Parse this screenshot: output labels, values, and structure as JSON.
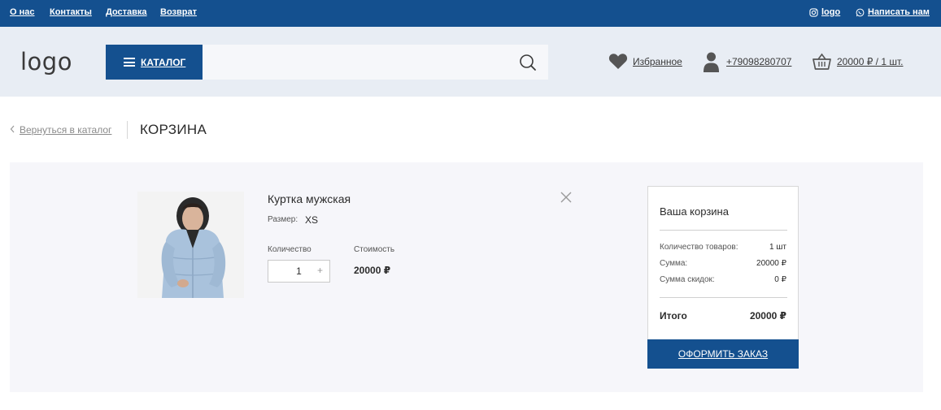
{
  "topbar": {
    "links": [
      "О нас",
      "Контакты",
      "Доставка",
      "Возврат"
    ],
    "instagram_label": "logo",
    "whatsapp_label": "Написать нам",
    "instagram_icon": "instagram-icon",
    "whatsapp_icon": "whatsapp-icon"
  },
  "header": {
    "logo": "logo",
    "catalog_label": "КАТАЛОГ",
    "search_placeholder": "",
    "favorites_label": "Избранное",
    "phone": "+79098280707",
    "cart_label": "20000 ₽ / 1 шт."
  },
  "breadcrumb": {
    "back_label": "Вернуться в каталог",
    "title": "КОРЗИНА"
  },
  "cart_item": {
    "name": "Куртка мужская",
    "size_label": "Размер:",
    "size_value": "XS",
    "quantity_label": "Количество",
    "quantity": "1",
    "cost_label": "Стоимость",
    "price": "20000 ₽"
  },
  "summary": {
    "title": "Ваша корзина",
    "rows": [
      {
        "label": "Количество товаров:",
        "value": "1 шт"
      },
      {
        "label": "Сумма:",
        "value": "20000 ₽"
      },
      {
        "label": "Сумма скидок:",
        "value": "0 ₽"
      }
    ],
    "total_label": "Итого",
    "total_value": "20000 ₽",
    "checkout_label": "ОФОРМИТЬ ЗАКАЗ"
  },
  "colors": {
    "brand": "#14508f",
    "header_bg": "#e8edf4",
    "panel_bg": "#f6f6fa"
  }
}
